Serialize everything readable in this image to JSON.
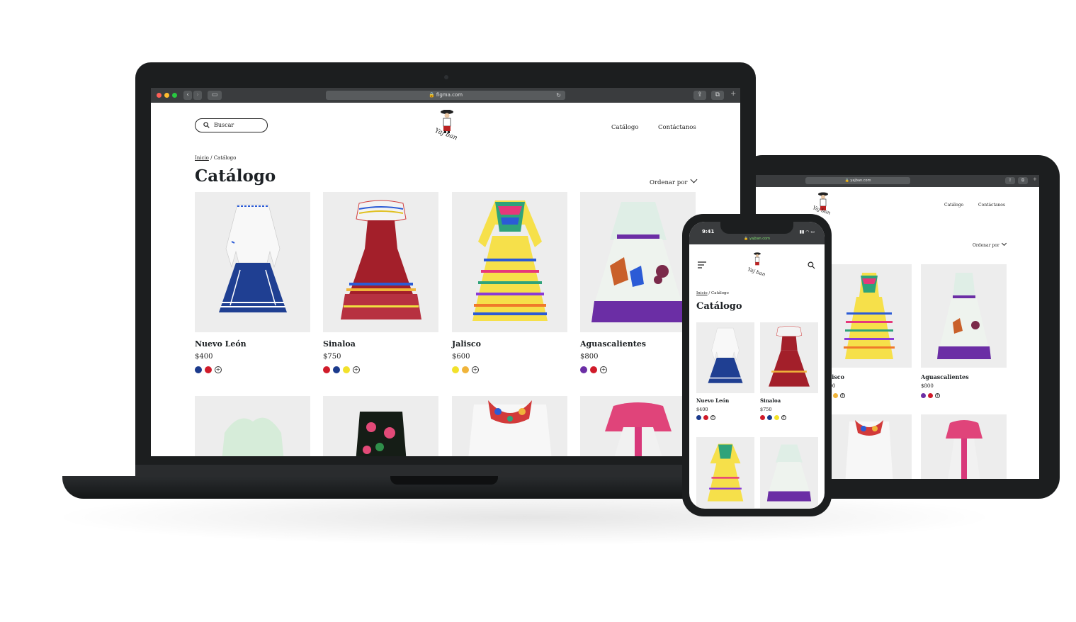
{
  "laptop": {
    "browser_url": "figma.com",
    "search_placeholder": "Buscar",
    "logo_text": "Yaj ban",
    "nav": [
      "Catálogo",
      "Contáctanos"
    ],
    "breadcrumb": {
      "home": "Inicio",
      "sep": " / ",
      "current": "Catálogo"
    },
    "title": "Catálogo",
    "sort_label": "Ordenar por",
    "products": [
      {
        "name": "Nuevo León",
        "price": "$400",
        "swatches": [
          "#1b3a8c",
          "#d01b2a"
        ]
      },
      {
        "name": "Sinaloa",
        "price": "$750",
        "swatches": [
          "#d01b2a",
          "#1b3a8c",
          "#f2e12b"
        ]
      },
      {
        "name": "Jalisco",
        "price": "$600",
        "swatches": [
          "#f2e12b",
          "#f0b43a"
        ]
      },
      {
        "name": "Aguascalientes",
        "price": "$800",
        "swatches": [
          "#6b2ea5",
          "#d01b2a"
        ]
      }
    ]
  },
  "tablet": {
    "browser_url": "yajban.com",
    "logo_text": "Yaj ban",
    "nav": [
      "Catálogo",
      "Contáctanos"
    ],
    "sort_label": "Ordenar por",
    "products": [
      {
        "name": "alisco",
        "price": "600",
        "swatches": [
          "#f2e12b",
          "#f0b43a"
        ]
      },
      {
        "name": "Aguascalientes",
        "price": "$800",
        "swatches": [
          "#6b2ea5",
          "#d01b2a"
        ]
      }
    ]
  },
  "phone": {
    "time": "9:41",
    "browser_url": "yajban.com",
    "logo_text": "Yaj ban",
    "breadcrumb": {
      "home": "Inicio",
      "sep": " / ",
      "current": "Catálogo"
    },
    "title": "Catálogo",
    "products": [
      {
        "name": "Nuevo León",
        "price": "$400",
        "swatches": [
          "#1b3a8c",
          "#d01b2a"
        ]
      },
      {
        "name": "Sinaloa",
        "price": "$750",
        "swatches": [
          "#d01b2a",
          "#1b3a8c",
          "#f2e12b"
        ]
      }
    ]
  },
  "colors": {
    "frame": "#1c1e1f",
    "card_bg": "#ededed",
    "browser_chrome": "#3a3c3e"
  }
}
